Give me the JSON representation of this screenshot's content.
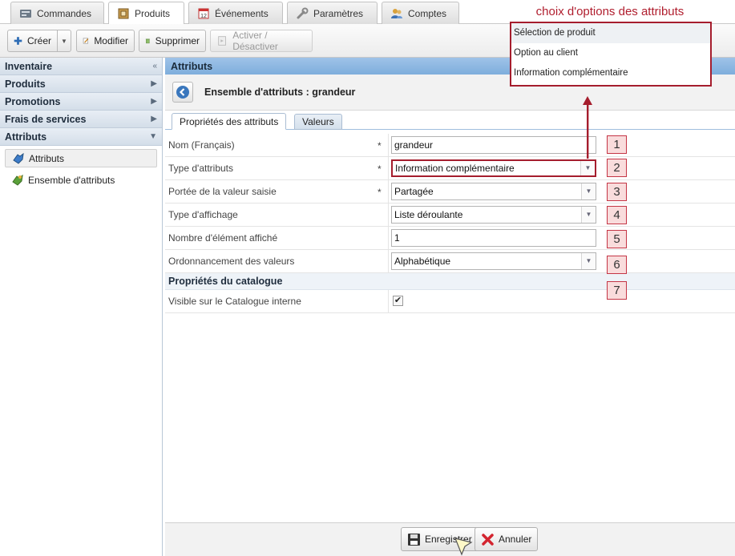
{
  "top_tabs": [
    "Commandes",
    "Produits",
    "Événements",
    "Paramètres",
    "Comptes"
  ],
  "toolbar": {
    "create": "Créer",
    "modify": "Modifier",
    "delete": "Supprimer",
    "toggle": "Activer / Désactiver"
  },
  "sidebar": {
    "sections": [
      {
        "label": "Inventaire",
        "arrow": "«"
      },
      {
        "label": "Produits",
        "arrow": "▶"
      },
      {
        "label": "Promotions",
        "arrow": "▶"
      },
      {
        "label": "Frais de services",
        "arrow": "▶"
      },
      {
        "label": "Attributs",
        "arrow": "▼"
      }
    ],
    "items": [
      "Attributs",
      "Ensemble d'attributs"
    ]
  },
  "main": {
    "panel_title": "Attributs",
    "header_title": "Ensemble d'attributs : grandeur",
    "tabs": [
      "Propriétés des attributs",
      "Valeurs"
    ],
    "fields": [
      {
        "label": "Nom (Français)",
        "required": "*",
        "value": "grandeur"
      },
      {
        "label": "Type d'attributs",
        "required": "*",
        "value": "Information complémentaire"
      },
      {
        "label": "Portée de la valeur saisie",
        "required": "*",
        "value": "Partagée"
      },
      {
        "label": "Type d'affichage",
        "required": "",
        "value": "Liste déroulante"
      },
      {
        "label": "Nombre d'élément affiché",
        "required": "",
        "value": "1"
      },
      {
        "label": "Ordonnancement des valeurs",
        "required": "",
        "value": "Alphabétique"
      }
    ],
    "catalog_section": "Propriétés du catalogue",
    "catalog_field": {
      "label": "Visible sur le Catalogue interne",
      "checked": true,
      "check_glyph": "✔"
    },
    "footer": {
      "save": "Enregistrer",
      "cancel": "Annuler"
    }
  },
  "badges": [
    "1",
    "2",
    "3",
    "4",
    "5",
    "6",
    "7"
  ],
  "annotation": {
    "title": "choix d'options des attributs",
    "options": [
      "Sélection de produit",
      "Option au client",
      "Information complémentaire"
    ]
  },
  "colors": {
    "accent_red": "#a51d2d",
    "panel_blue": "#8db8e2"
  }
}
